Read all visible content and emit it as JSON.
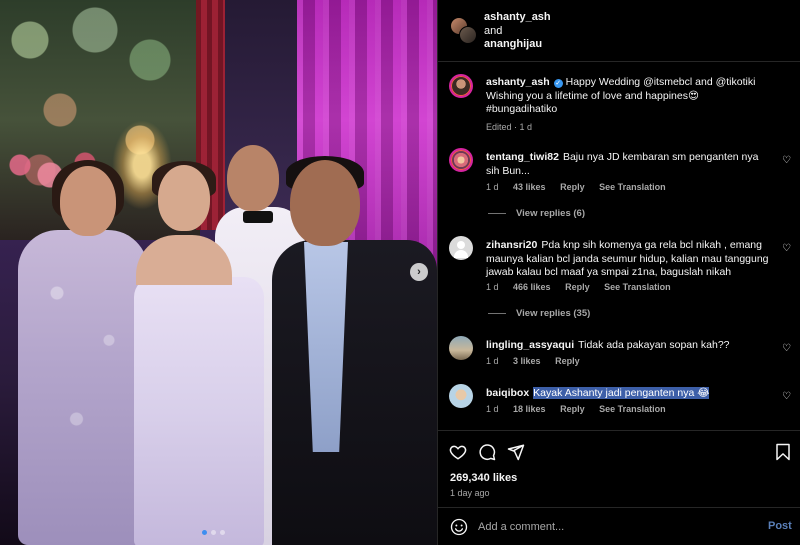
{
  "header": {
    "user1": "ashanty_ash",
    "connector": "and",
    "user2": "ananghijau"
  },
  "caption": {
    "username": "ashanty_ash",
    "text": "Happy Wedding @itsmebcl and @tikotiki Wishing you a lifetime of love and happines😍 #bungadihatiko",
    "edited": "Edited · 1 d"
  },
  "comments": [
    {
      "username": "tentang_tiwi82",
      "text": "Baju nya JD kembaran sm penganten nya sih Bun...",
      "time": "1 d",
      "likes": "43 likes",
      "reply": "Reply",
      "translate": "See Translation",
      "view_replies": "View replies (6)"
    },
    {
      "username": "zihansri20",
      "text": "Pda knp sih komenya ga rela bcl nikah , emang maunya kalian bcl janda seumur hidup, kalian mau tanggung jawab kalau bcl maaf ya smpai z1na, baguslah nikah",
      "time": "1 d",
      "likes": "466 likes",
      "reply": "Reply",
      "translate": "See Translation",
      "view_replies": "View replies (35)"
    },
    {
      "username": "lingling_assyaqui",
      "text": "Tidak ada pakayan sopan kah??",
      "time": "1 d",
      "likes": "3 likes",
      "reply": "Reply"
    },
    {
      "username": "baiqibox",
      "text": "Kayak Ashanty jadi penganten nya 😂",
      "time": "1 d",
      "likes": "18 likes",
      "reply": "Reply",
      "translate": "See Translation"
    }
  ],
  "post": {
    "likes": "269,340 likes",
    "time": "1 day ago"
  },
  "composer": {
    "placeholder": "Add a comment...",
    "post_label": "Post"
  },
  "colors": {
    "background": "#000000",
    "accent": "#3897f0",
    "muted": "#a8a8a8",
    "highlight": "#3d5fa8"
  },
  "icons": [
    "chevron-right-icon",
    "heart-icon",
    "comment-icon",
    "share-icon",
    "bookmark-icon",
    "emoji-icon",
    "verified-icon"
  ]
}
